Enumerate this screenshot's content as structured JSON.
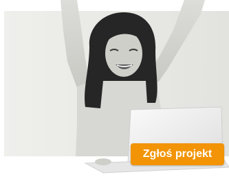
{
  "cta": {
    "label": "Zgłoś projekt"
  },
  "colors": {
    "button_background": "#f29406",
    "button_text": "#ffffff",
    "backdrop": "#e9e9e6"
  },
  "image": {
    "subject": "photo-woman-celebrating-at-laptop"
  }
}
